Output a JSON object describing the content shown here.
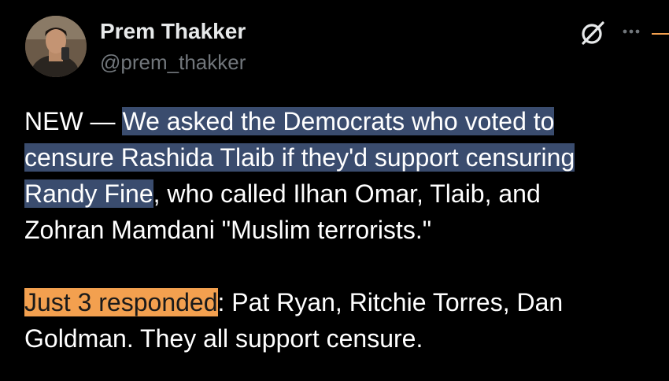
{
  "author": {
    "display_name": "Prem Thakker",
    "handle": "@prem_thakker"
  },
  "icons": {
    "grok": "grok-icon",
    "more": "more-options-icon"
  },
  "tweet": {
    "line1_prefix": "NEW — ",
    "line1_hl": "We asked the Democrats who voted to ",
    "line2_hl": "censure Rashida Tlaib if they'd support censuring ",
    "line3_hl": "Randy Fine",
    "line3_rest": ", who called Ilhan Omar, Tlaib, and",
    "line4": "Zohran Mamdani \"Muslim terrorists.\"",
    "line5_hl": "Just 3 responded",
    "line5_rest": ": Pat Ryan, Ritchie Torres, Dan",
    "line6": "Goldman. They all support censure."
  },
  "colors": {
    "background": "#000000",
    "text": "#ffffff",
    "handle": "#71767b",
    "highlight_blue": "#3a4c6e",
    "highlight_orange": "#f3a04f"
  }
}
